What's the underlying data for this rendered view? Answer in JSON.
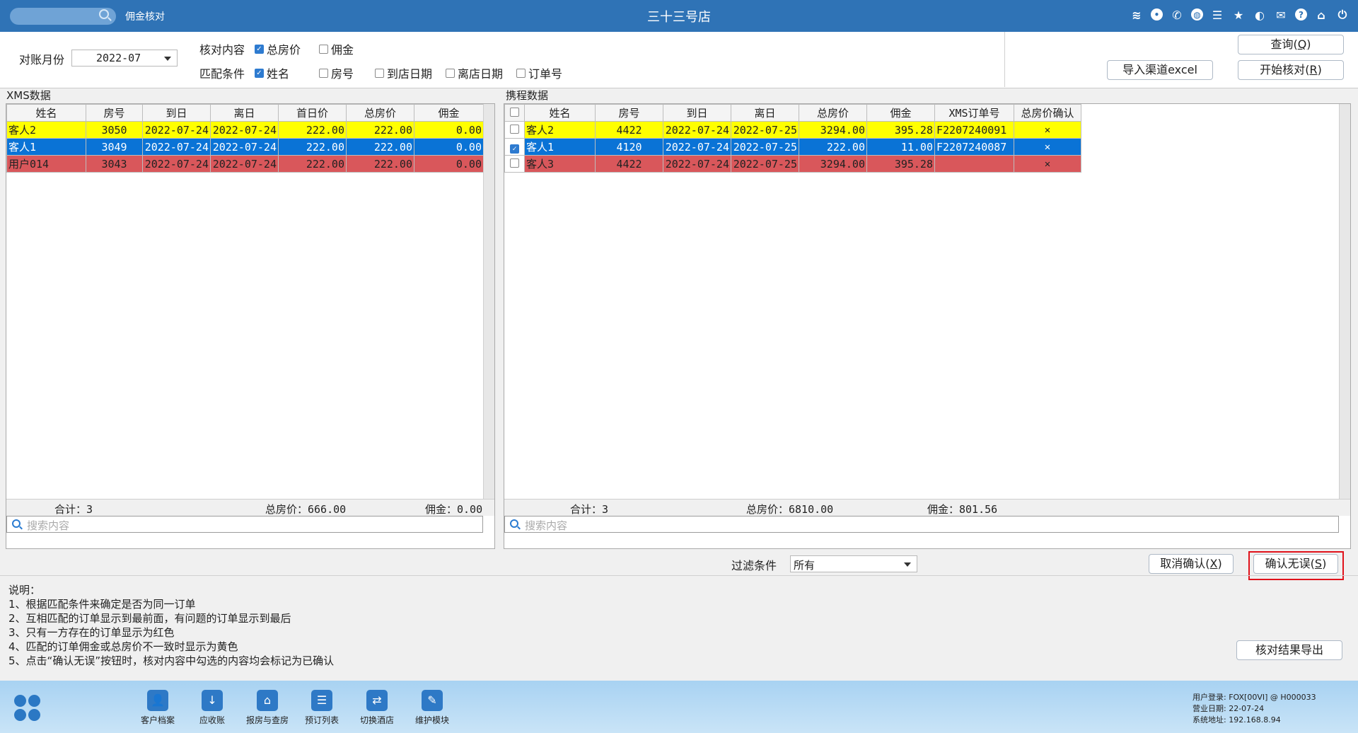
{
  "titlebar": {
    "module_name": "佣金核对",
    "store_name": "三十三号店",
    "icons": [
      "wifi-icon",
      "chat-icon",
      "phone-icon",
      "palette-icon",
      "menu-icon",
      "star-icon",
      "theme-icon",
      "mail-icon",
      "help-icon",
      "home-icon",
      "power-icon"
    ]
  },
  "controls": {
    "month_label": "对账月份",
    "month_value": "2022-07",
    "check_content_label": "核对内容",
    "check_total_price": "总房价",
    "check_commission": "佣金",
    "match_label": "匹配条件",
    "match_name": "姓名",
    "match_room": "房号",
    "match_arrival": "到店日期",
    "match_departure": "离店日期",
    "match_order": "订单号",
    "import_button": "导入渠道excel",
    "query_button": "查询",
    "query_key": "Q",
    "start_button": "开始核对",
    "start_key": "R"
  },
  "xms": {
    "title": "XMS数据",
    "columns": [
      "姓名",
      "房号",
      "到日",
      "离日",
      "首日价",
      "总房价",
      "佣金"
    ],
    "rows": [
      {
        "style": "yellow",
        "cells": [
          "客人2",
          "3050",
          "2022-07-24",
          "2022-07-24",
          "222.00",
          "222.00",
          "0.00"
        ]
      },
      {
        "style": "blue",
        "cells": [
          "客人1",
          "3049",
          "2022-07-24",
          "2022-07-24",
          "222.00",
          "222.00",
          "0.00"
        ]
      },
      {
        "style": "red",
        "cells": [
          "用户014",
          "3043",
          "2022-07-24",
          "2022-07-24",
          "222.00",
          "222.00",
          "0.00"
        ]
      }
    ],
    "footer_count": "合计：3",
    "footer_total": "总房价：666.00",
    "footer_commission": "佣金：0.00",
    "search_placeholder": "搜索内容"
  },
  "ctrip": {
    "title": "携程数据",
    "columns": [
      "姓名",
      "房号",
      "到日",
      "离日",
      "总房价",
      "佣金",
      "XMS订单号",
      "总房价确认"
    ],
    "rows": [
      {
        "style": "yellow",
        "checked": false,
        "cells": [
          "客人2",
          "4422",
          "2022-07-24",
          "2022-07-25",
          "3294.00",
          "395.28",
          "F2207240091",
          "✕"
        ]
      },
      {
        "style": "blue",
        "checked": true,
        "cells": [
          "客人1",
          "4120",
          "2022-07-24",
          "2022-07-25",
          "222.00",
          "11.00",
          "F2207240087",
          "✕"
        ]
      },
      {
        "style": "red",
        "checked": false,
        "cells": [
          "客人3",
          "4422",
          "2022-07-24",
          "2022-07-25",
          "3294.00",
          "395.28",
          "",
          "✕"
        ]
      }
    ],
    "footer_count": "合计：3",
    "footer_total": "总房价：6810.00",
    "footer_commission": "佣金：801.56",
    "search_placeholder": "搜索内容"
  },
  "filter": {
    "label": "过滤条件",
    "value": "所有",
    "cancel_button": "取消确认",
    "cancel_key": "X",
    "confirm_button": "确认无误",
    "confirm_key": "S",
    "export_button": "核对结果导出"
  },
  "notes": [
    "说明：",
    "1、根据匹配条件来确定是否为同一订单",
    "2、互相匹配的订单显示到最前面，有问题的订单显示到最后",
    "3、只有一方存在的订单显示为红色",
    "4、匹配的订单佣金或总房价不一致时显示为黄色",
    "5、点击“确认无误”按钮时，核对内容中勾选的内容均会标记为已确认"
  ],
  "taskbar": {
    "items": [
      {
        "label": "客户档案",
        "icon": "customer-file-icon"
      },
      {
        "label": "应收账",
        "icon": "receivable-icon"
      },
      {
        "label": "报房与查房",
        "icon": "room-status-icon"
      },
      {
        "label": "预订列表",
        "icon": "booking-list-icon"
      },
      {
        "label": "切换酒店",
        "icon": "switch-hotel-icon"
      },
      {
        "label": "维护模块",
        "icon": "maintenance-icon"
      }
    ],
    "user_login_label": "用户登录:",
    "user_login_value": "FOX[00VI] @ H000033",
    "business_date_label": "营业日期:",
    "business_date_value": "22-07-24",
    "system_address_label": "系统地址:",
    "system_address_value": "192.168.8.94"
  },
  "colors": {
    "titlebar": "#2f73b6",
    "row_yellow": "#ffff00",
    "row_blue": "#0a73d6",
    "row_red": "#d9575b",
    "highlight_border": "#e0121b"
  }
}
